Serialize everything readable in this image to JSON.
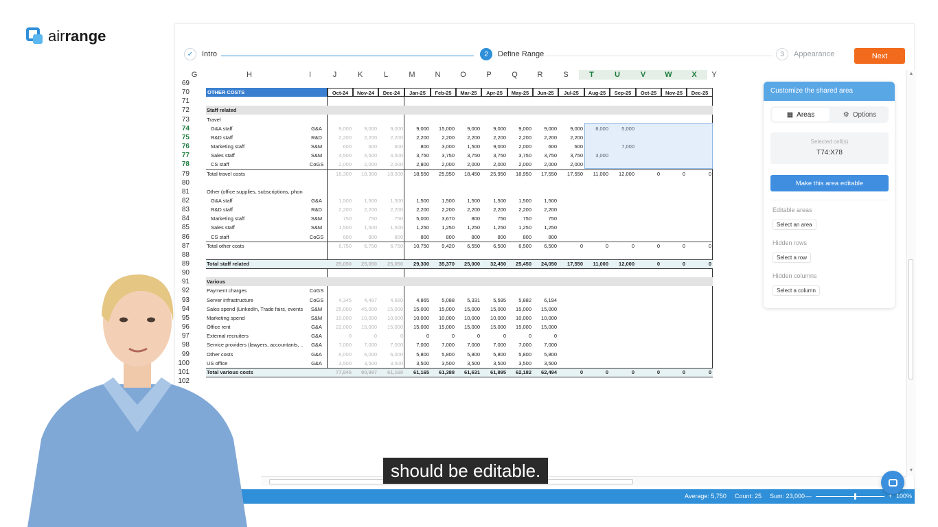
{
  "logo": {
    "pre": "air",
    "bold": "range"
  },
  "stepper": {
    "steps": [
      {
        "num": "✓",
        "label": "Intro"
      },
      {
        "num": "2",
        "label": "Define Range"
      },
      {
        "num": "3",
        "label": "Appearance"
      }
    ],
    "next_label": "Next"
  },
  "columns": [
    "G",
    "H",
    "I",
    "J",
    "K",
    "L",
    "M",
    "N",
    "O",
    "P",
    "Q",
    "R",
    "S",
    "T",
    "U",
    "V",
    "W",
    "X",
    "Y"
  ],
  "selected_columns": [
    "T",
    "U",
    "V",
    "W",
    "X"
  ],
  "row_numbers": [
    "69",
    "70",
    "71",
    "72",
    "73",
    "74",
    "75",
    "76",
    "77",
    "78",
    "79",
    "80",
    "81",
    "82",
    "83",
    "84",
    "85",
    "86",
    "87",
    "88",
    "89",
    "90",
    "91",
    "92",
    "93",
    "94",
    "95",
    "96",
    "97",
    "98",
    "99",
    "100",
    "101",
    "102"
  ],
  "selected_rows": [
    "74",
    "75",
    "76",
    "77",
    "78"
  ],
  "sheet": {
    "title": "OTHER COSTS",
    "months": [
      "Oct-24",
      "Nov-24",
      "Dec-24",
      "Jan-25",
      "Feb-25",
      "Mar-25",
      "Apr-25",
      "May-25",
      "Jun-25",
      "Jul-25",
      "Aug-25",
      "Sep-25",
      "Oct-25",
      "Nov-25",
      "Dec-25"
    ],
    "rows": [
      {
        "r": "72",
        "label": "Staff related",
        "bold": true,
        "band": true,
        "dept": "",
        "vals": []
      },
      {
        "r": "73",
        "label": "Travel",
        "dept": "",
        "vals": []
      },
      {
        "r": "74",
        "label": "G&A staff",
        "indent": true,
        "dept": "G&A",
        "vals": [
          "9,000",
          "9,000",
          "9,000",
          "9,000",
          "15,000",
          "9,000",
          "9,000",
          "9,000",
          "9,000",
          "9,000",
          "8,000",
          "5,000",
          "",
          "",
          ""
        ]
      },
      {
        "r": "75",
        "label": "R&D staff",
        "indent": true,
        "dept": "R&D",
        "vals": [
          "2,200",
          "2,200",
          "2,200",
          "2,200",
          "2,200",
          "2,200",
          "2,200",
          "2,200",
          "2,200",
          "2,200",
          "",
          "",
          "",
          "",
          ""
        ]
      },
      {
        "r": "76",
        "label": "Marketing staff",
        "indent": true,
        "dept": "S&M",
        "vals": [
          "600",
          "600",
          "600",
          "800",
          "3,000",
          "1,500",
          "9,000",
          "2,000",
          "600",
          "600",
          "",
          "7,000",
          "",
          "",
          ""
        ]
      },
      {
        "r": "77",
        "label": "Sales staff",
        "indent": true,
        "dept": "S&M",
        "vals": [
          "4,500",
          "4,500",
          "4,500",
          "3,750",
          "3,750",
          "3,750",
          "3,750",
          "3,750",
          "3,750",
          "3,750",
          "3,000",
          "",
          "",
          "",
          ""
        ]
      },
      {
        "r": "78",
        "label": "CS staff",
        "indent": true,
        "dept": "CoGS",
        "vals": [
          "2,000",
          "2,000",
          "2,000",
          "2,800",
          "2,000",
          "2,000",
          "2,000",
          "2,000",
          "2,000",
          "2,000",
          "",
          "",
          "",
          "",
          ""
        ]
      },
      {
        "r": "79",
        "label": "Total travel costs",
        "total": true,
        "dept": "",
        "vals": [
          "18,300",
          "18,300",
          "18,300",
          "18,550",
          "25,950",
          "18,450",
          "25,950",
          "18,950",
          "17,550",
          "17,550",
          "11,000",
          "12,000",
          "0",
          "0",
          "0"
        ]
      },
      {
        "r": "80",
        "label": "",
        "dept": "",
        "vals": []
      },
      {
        "r": "81",
        "label": "Other (office supplies, subscriptions, phone",
        "dept": "",
        "vals": []
      },
      {
        "r": "82",
        "label": "G&A staff",
        "indent": true,
        "dept": "G&A",
        "vals": [
          "1,500",
          "1,500",
          "1,500",
          "1,500",
          "1,500",
          "1,500",
          "1,500",
          "1,500",
          "1,500",
          "",
          "",
          "",
          "",
          "",
          ""
        ]
      },
      {
        "r": "83",
        "label": "R&D staff",
        "indent": true,
        "dept": "R&D",
        "vals": [
          "2,200",
          "2,200",
          "2,200",
          "2,200",
          "2,200",
          "2,200",
          "2,200",
          "2,200",
          "2,200",
          "",
          "",
          "",
          "",
          "",
          ""
        ]
      },
      {
        "r": "84",
        "label": "Marketing staff",
        "indent": true,
        "dept": "S&M",
        "vals": [
          "750",
          "750",
          "750",
          "5,000",
          "3,670",
          "800",
          "750",
          "750",
          "750",
          "",
          "",
          "",
          "",
          "",
          ""
        ]
      },
      {
        "r": "85",
        "label": "Sales staff",
        "indent": true,
        "dept": "S&M",
        "vals": [
          "1,500",
          "1,500",
          "1,500",
          "1,250",
          "1,250",
          "1,250",
          "1,250",
          "1,250",
          "1,250",
          "",
          "",
          "",
          "",
          "",
          ""
        ]
      },
      {
        "r": "86",
        "label": "CS staff",
        "indent": true,
        "dept": "CoGS",
        "vals": [
          "800",
          "800",
          "800",
          "800",
          "800",
          "800",
          "800",
          "800",
          "800",
          "",
          "",
          "",
          "",
          "",
          ""
        ]
      },
      {
        "r": "87",
        "label": "Total other costs",
        "total": true,
        "dept": "",
        "vals": [
          "6,750",
          "6,750",
          "6,750",
          "10,750",
          "9,420",
          "6,550",
          "6,500",
          "6,500",
          "6,500",
          "0",
          "0",
          "0",
          "0",
          "0",
          "0"
        ]
      },
      {
        "r": "88",
        "label": "",
        "dept": "",
        "vals": []
      },
      {
        "r": "89",
        "label": "Total staff related",
        "bold": true,
        "grand": true,
        "dept": "",
        "vals": [
          "25,050",
          "25,050",
          "25,050",
          "29,300",
          "35,370",
          "25,000",
          "32,450",
          "25,450",
          "24,050",
          "17,550",
          "11,000",
          "12,000",
          "0",
          "0",
          "0"
        ]
      },
      {
        "r": "90",
        "label": "",
        "dept": "",
        "vals": []
      },
      {
        "r": "91",
        "label": "Various",
        "bold": true,
        "band": true,
        "dept": "",
        "vals": []
      },
      {
        "r": "92",
        "label": "Payment charges",
        "dept": "CoGS",
        "vals": []
      },
      {
        "r": "93",
        "label": "Server infrastructure",
        "dept": "CoGS",
        "vals": [
          "4,345",
          "4,497",
          "4,660",
          "4,865",
          "5,088",
          "5,331",
          "5,595",
          "5,882",
          "6,194",
          "",
          "",
          "",
          "",
          "",
          ""
        ]
      },
      {
        "r": "94",
        "label": "Sales spend (LinkedIn, Trade fairs, events)",
        "dept": "S&M",
        "vals": [
          "25,000",
          "45,000",
          "15,000",
          "15,000",
          "15,000",
          "15,000",
          "15,000",
          "15,000",
          "15,000",
          "",
          "",
          "",
          "",
          "",
          ""
        ]
      },
      {
        "r": "95",
        "label": "Marketing spend",
        "dept": "S&M",
        "vals": [
          "10,000",
          "10,000",
          "10,000",
          "10,000",
          "10,000",
          "10,000",
          "10,000",
          "10,000",
          "10,000",
          "",
          "",
          "",
          "",
          "",
          ""
        ]
      },
      {
        "r": "96",
        "label": "Office rent",
        "dept": "G&A",
        "vals": [
          "22,000",
          "15,000",
          "15,000",
          "15,000",
          "15,000",
          "15,000",
          "15,000",
          "15,000",
          "15,000",
          "",
          "",
          "",
          "",
          "",
          ""
        ]
      },
      {
        "r": "97",
        "label": "External recruiters",
        "dept": "G&A",
        "vals": [
          "0",
          "0",
          "0",
          "0",
          "0",
          "0",
          "0",
          "0",
          "0",
          "",
          "",
          "",
          "",
          "",
          ""
        ]
      },
      {
        "r": "98",
        "label": "Service providers (lawyers, accountants, ...",
        "dept": "G&A",
        "vals": [
          "7,000",
          "7,000",
          "7,000",
          "7,000",
          "7,000",
          "7,000",
          "7,000",
          "7,000",
          "7,000",
          "",
          "",
          "",
          "",
          "",
          ""
        ]
      },
      {
        "r": "99",
        "label": "Other costs",
        "dept": "G&A",
        "vals": [
          "6,000",
          "6,000",
          "6,000",
          "5,800",
          "5,800",
          "5,800",
          "5,800",
          "5,800",
          "5,800",
          "",
          "",
          "",
          "",
          "",
          ""
        ]
      },
      {
        "r": "100",
        "label": "US office",
        "dept": "G&A",
        "vals": [
          "3,500",
          "3,500",
          "3,500",
          "3,500",
          "3,500",
          "3,500",
          "3,500",
          "3,500",
          "3,500",
          "",
          "",
          "",
          "",
          "",
          ""
        ]
      },
      {
        "r": "101",
        "label": "Total various costs",
        "bold": true,
        "grand": true,
        "dept": "",
        "vals": [
          "77,845",
          "90,997",
          "61,160",
          "61,165",
          "61,388",
          "61,631",
          "61,895",
          "62,182",
          "62,494",
          "0",
          "0",
          "0",
          "0",
          "0",
          "0"
        ]
      }
    ]
  },
  "panel": {
    "title": "Customize the shared area",
    "tab_areas": "Areas",
    "tab_options": "Options",
    "selected_label": "Selected cell(s)",
    "selected_value": "T74:X78",
    "make_editable": "Make this area editable",
    "editable_areas": "Editable areas",
    "select_area": "Select an area",
    "hidden_rows": "Hidden rows",
    "select_row": "Select a row",
    "hidden_columns": "Hidden columns",
    "select_column": "Select a column"
  },
  "status": {
    "average": "Average: 5,750",
    "count": "Count: 25",
    "sum": "Sum: 23,000",
    "zoom": "100%",
    "minus": "—",
    "plus": "+"
  },
  "caption": "should be editable.",
  "colors": {
    "brand": "#2f8fd8",
    "next": "#f26b1d",
    "panel_head": "#5aa7e6",
    "selection": "#aecdf0"
  }
}
